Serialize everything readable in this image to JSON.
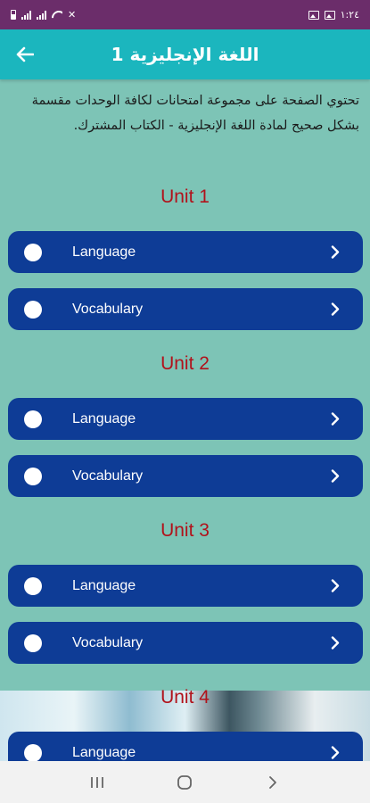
{
  "status_bar": {
    "time": "١:٢٤"
  },
  "header": {
    "title": "اللغة الإنجليزية 1"
  },
  "intro": {
    "text": "تحتوي الصفحة على مجموعة امتحانات لكافة الوحدات مقسمة بشكل صحيح لمادة اللغة الإنجليزية - الكتاب المشترك."
  },
  "units": [
    {
      "title": "Unit 1",
      "items": [
        {
          "label": "Language"
        },
        {
          "label": "Vocabulary"
        }
      ]
    },
    {
      "title": "Unit 2",
      "items": [
        {
          "label": "Language"
        },
        {
          "label": "Vocabulary"
        }
      ]
    },
    {
      "title": "Unit 3",
      "items": [
        {
          "label": "Language"
        },
        {
          "label": "Vocabulary"
        }
      ]
    },
    {
      "title": "Unit 4",
      "items": [
        {
          "label": "Language"
        }
      ]
    }
  ],
  "colors": {
    "status_bar": "#6b2d6a",
    "header": "#1bb6be",
    "background": "#7dc4b6",
    "button": "#0e3c96",
    "unit_title": "#b1121b"
  }
}
